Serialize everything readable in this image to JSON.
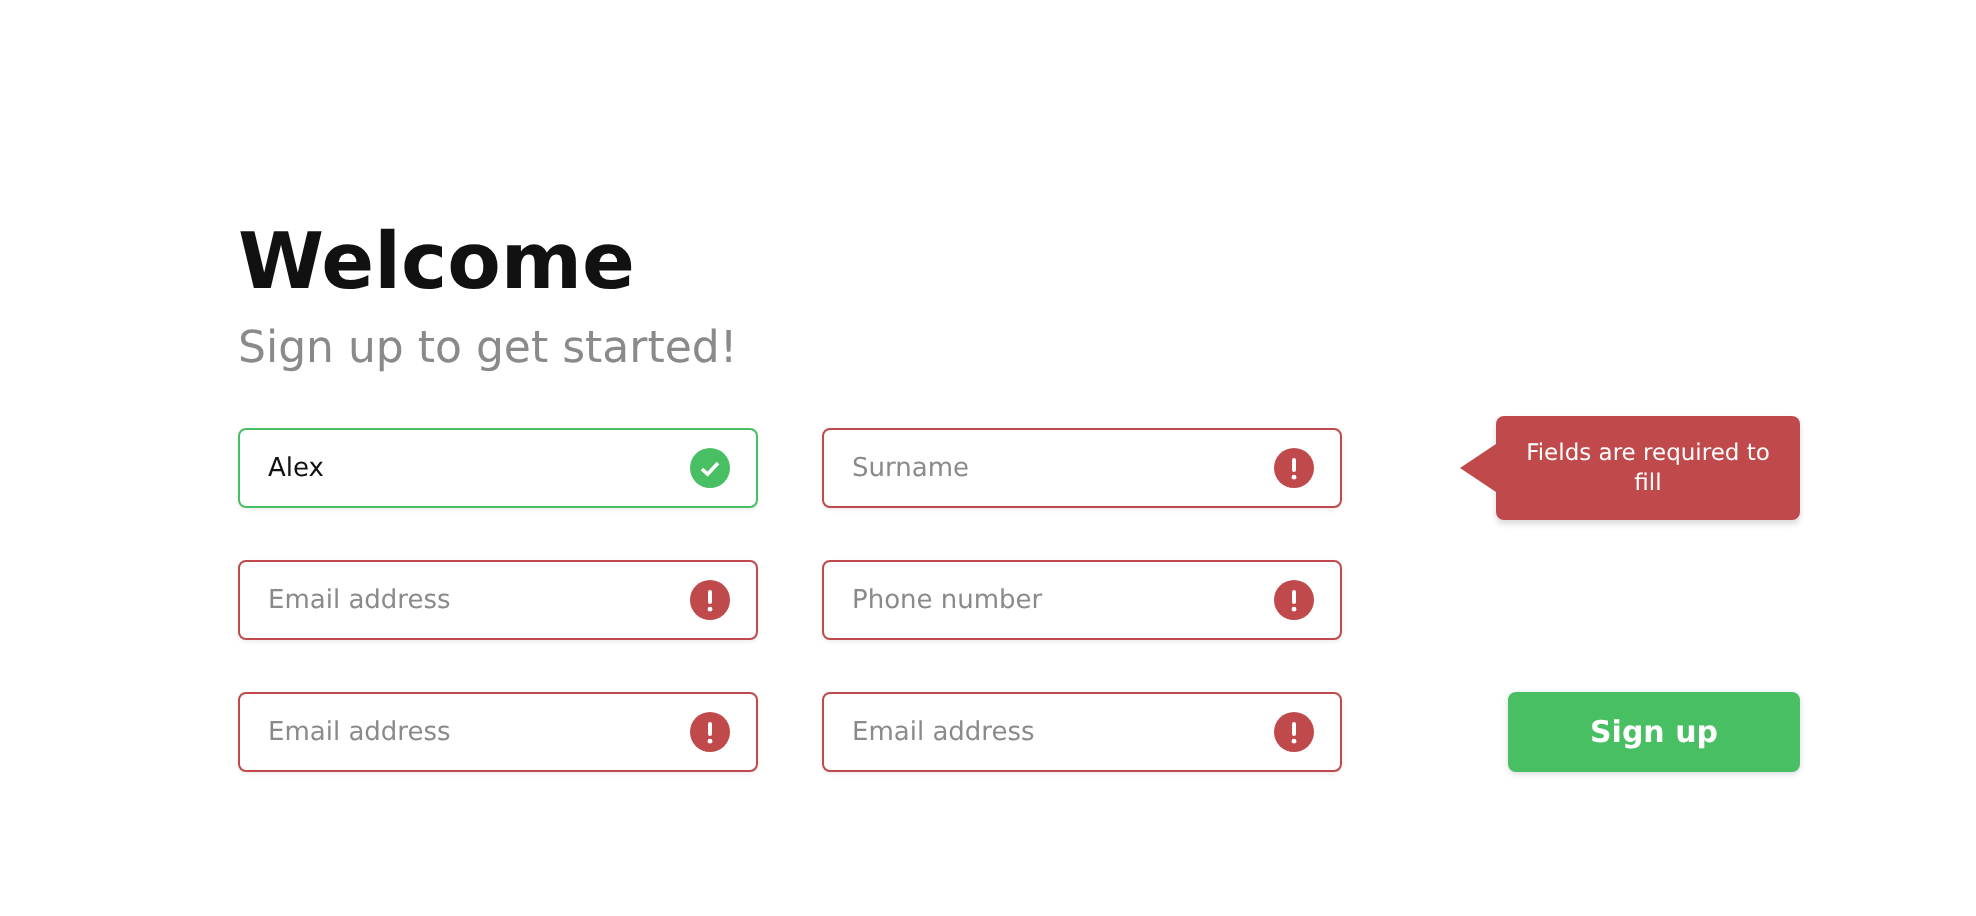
{
  "title": "Welcome",
  "subtitle": "Sign up to get started!",
  "fields": [
    {
      "value": "Alex",
      "error": false
    },
    {
      "placeholder": "Surname",
      "error": true
    },
    {
      "placeholder": "Email address",
      "error": true
    },
    {
      "placeholder": "Phone number",
      "error": true
    },
    {
      "placeholder": "Email address",
      "error": true
    },
    {
      "placeholder": "Email address",
      "error": true
    }
  ],
  "tooltip": "Fields are required to fill",
  "submit_button": "Sign up"
}
